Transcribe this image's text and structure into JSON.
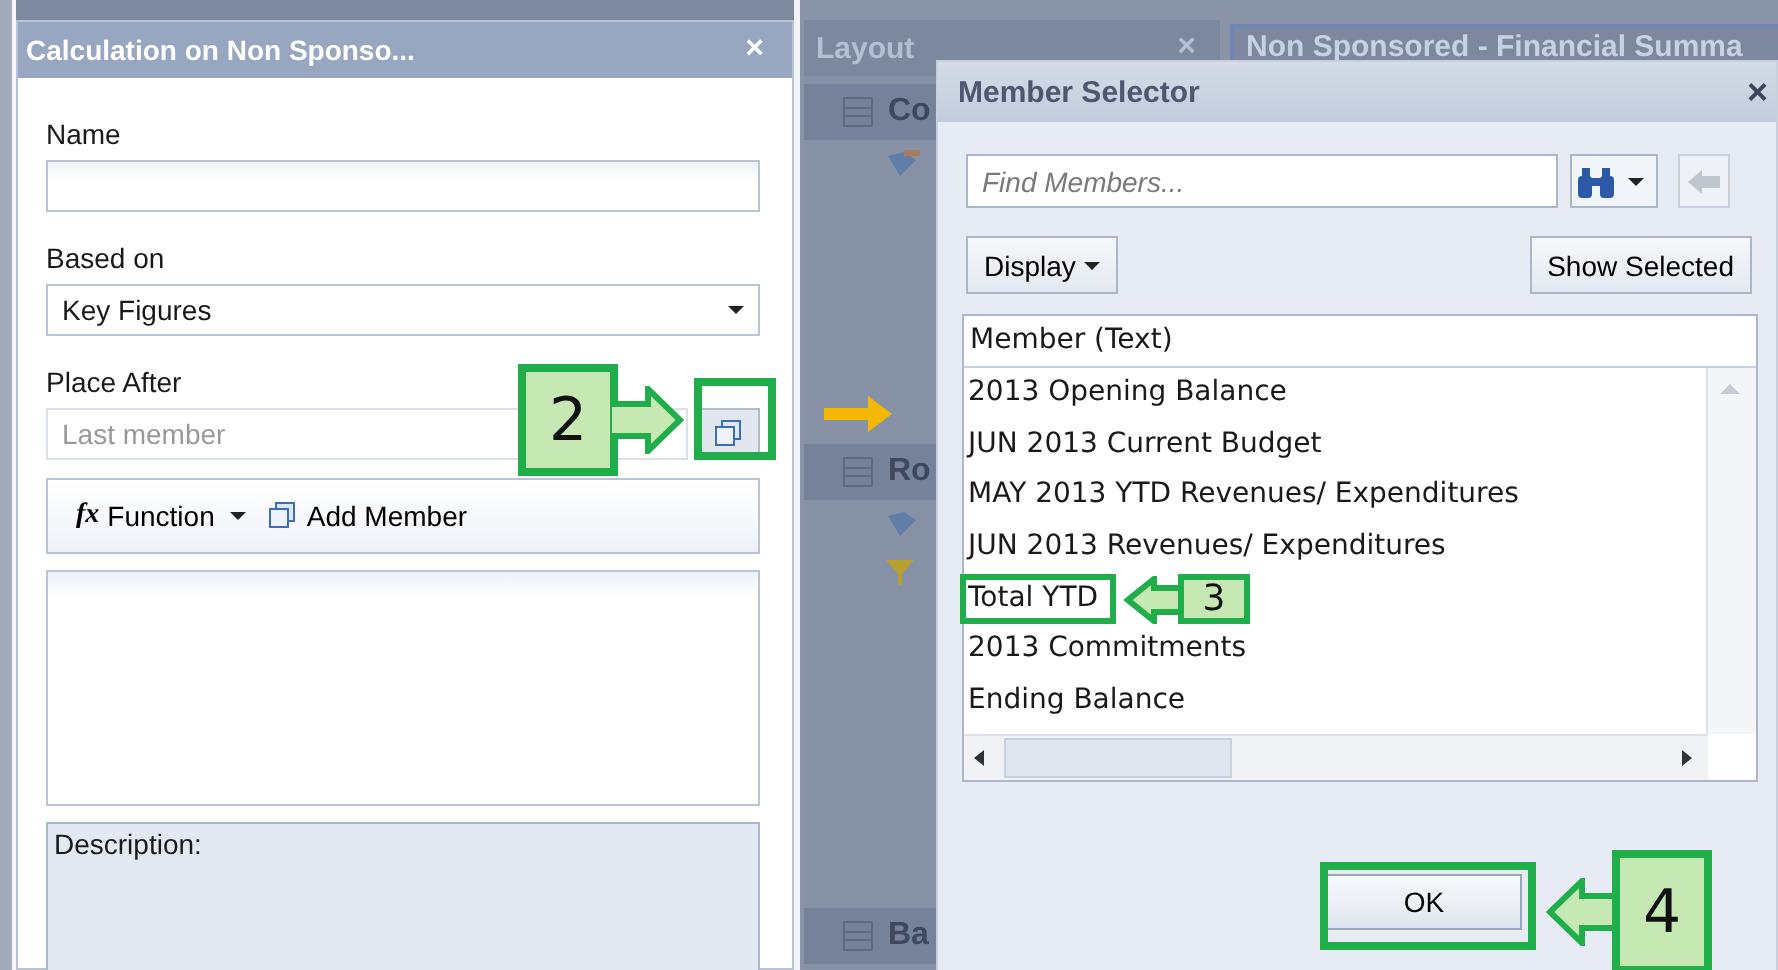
{
  "calc_dialog": {
    "title": "Calculation on Non Sponso...",
    "close": "×",
    "name_label": "Name",
    "based_on_label": "Based on",
    "based_on_value": "Key Figures",
    "place_after_label": "Place After",
    "place_after_placeholder": "Last member",
    "place_after_disabled": true,
    "function_icon": "fx",
    "function_button": "Function",
    "add_member_button": "Add Member",
    "description_label": "Description:"
  },
  "layout_panel": {
    "title": "Layout",
    "close": "×",
    "sections": [
      {
        "label": "Co"
      },
      {
        "label": "Ro"
      },
      {
        "label": "Ba"
      }
    ]
  },
  "document_tab": {
    "label": "Non Sponsored - Financial Summa"
  },
  "member_selector": {
    "title": "Member Selector",
    "close": "×",
    "search_placeholder": "Find Members...",
    "display_button": "Display",
    "show_selected_button": "Show Selected",
    "list_header": "Member (Text)",
    "members": [
      {
        "label": "2013 Opening Balance",
        "selected": false
      },
      {
        "label": "JUN 2013 Current Budget",
        "selected": false
      },
      {
        "label": "MAY 2013 YTD Revenues/ Expenditures",
        "selected": false
      },
      {
        "label": "JUN 2013 Revenues/ Expenditures",
        "selected": false
      },
      {
        "label": "Total YTD",
        "selected": true
      },
      {
        "label": "2013 Commitments",
        "selected": false
      },
      {
        "label": "Ending Balance",
        "selected": false
      }
    ],
    "ok_button": "OK"
  },
  "callouts": [
    {
      "number": "2"
    },
    {
      "number": "3"
    },
    {
      "number": "4"
    }
  ]
}
